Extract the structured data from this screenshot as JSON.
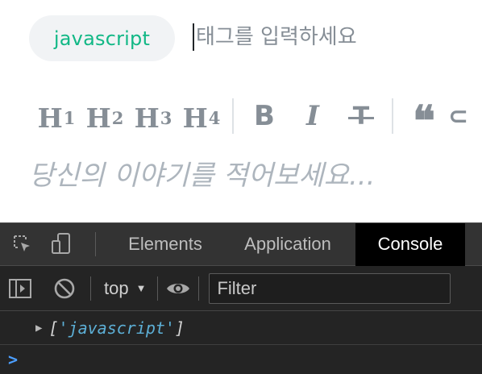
{
  "editor": {
    "tags": [
      "javascript"
    ],
    "tag_placeholder": "태그를 입력하세요",
    "toolbar": {
      "headings": [
        {
          "main": "H",
          "level": "1"
        },
        {
          "main": "H",
          "level": "2"
        },
        {
          "main": "H",
          "level": "3"
        },
        {
          "main": "H",
          "level": "4"
        }
      ],
      "bold": "B",
      "italic": "I",
      "strike": "T",
      "quote": "❝",
      "link": "⊂"
    },
    "body_placeholder": "당신의 이야기를 적어보세요..."
  },
  "devtools": {
    "tabs": [
      "Elements",
      "Application",
      "Console"
    ],
    "active_tab": "Console",
    "context": "top",
    "filter_placeholder": "Filter",
    "console": {
      "log_open": "[",
      "log_string": "'javascript'",
      "log_close": "]",
      "prompt": ">"
    }
  },
  "colors": {
    "accent": "#12b886",
    "tag_bg": "#f1f3f5",
    "muted": "#868e96",
    "devtools_bg": "#242424",
    "console_string": "#5db0d7"
  }
}
